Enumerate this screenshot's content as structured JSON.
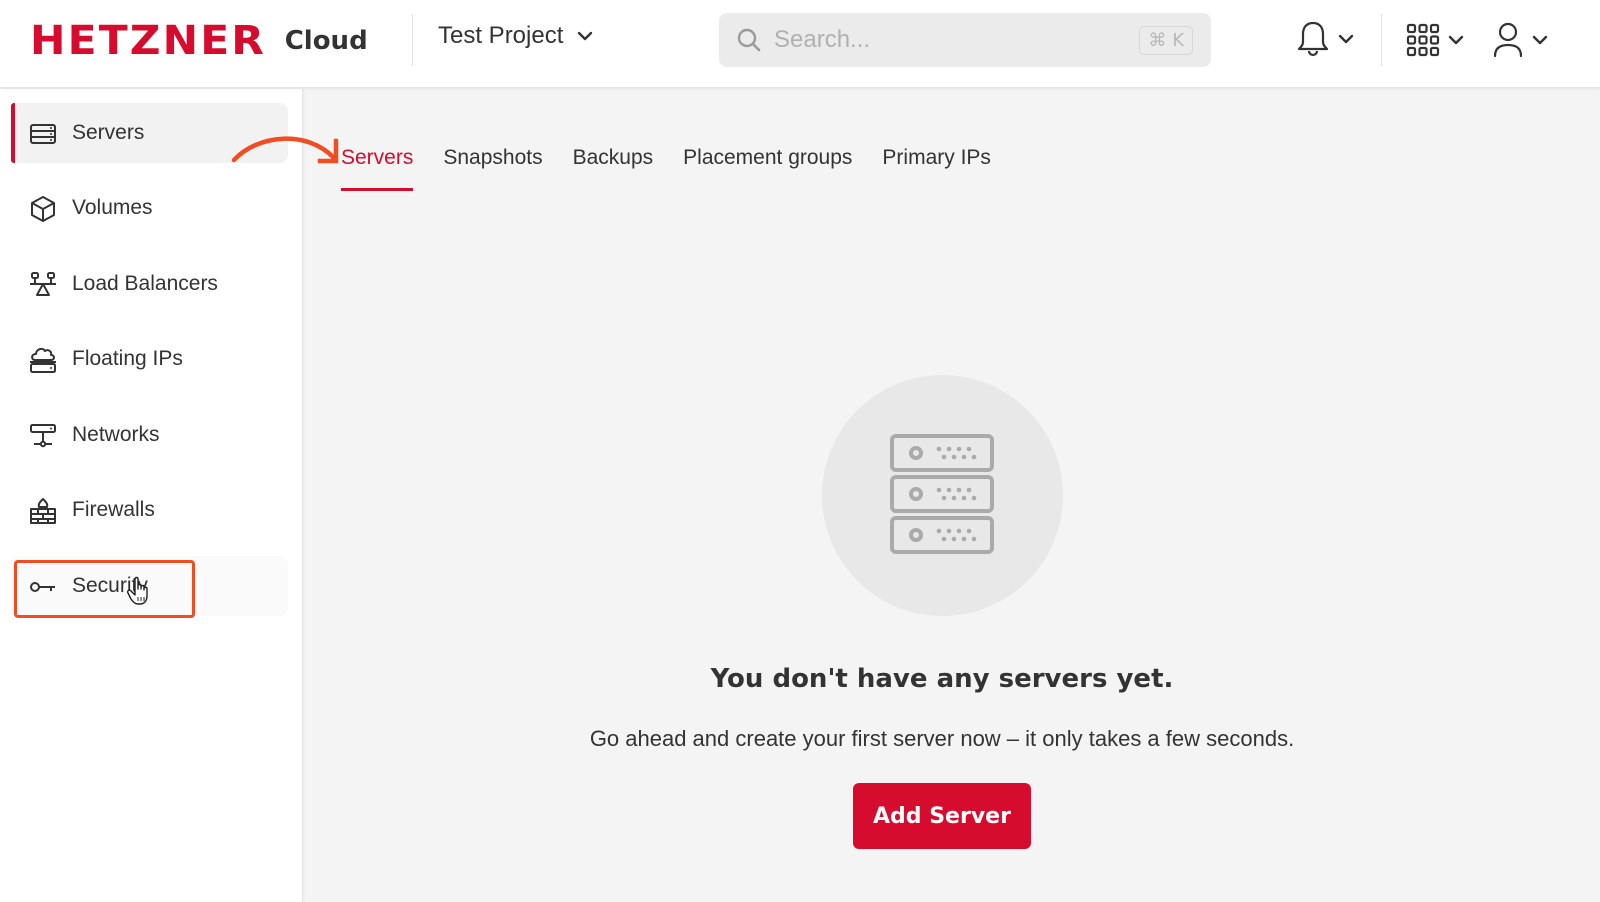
{
  "header": {
    "logo_text": "HETZNER",
    "product_label": "Cloud",
    "project": "Test Project",
    "search": {
      "placeholder": "Search...",
      "value": "",
      "shortcut": "⌘ K"
    },
    "icons": [
      "bell-icon",
      "app-grid-icon",
      "user-icon"
    ]
  },
  "sidebar": {
    "items": [
      {
        "label": "Servers",
        "icon": "server-icon",
        "active": true
      },
      {
        "label": "Volumes",
        "icon": "cube-icon",
        "active": false
      },
      {
        "label": "Load Balancers",
        "icon": "load-balancer-icon",
        "active": false
      },
      {
        "label": "Floating IPs",
        "icon": "floating-ip-icon",
        "active": false
      },
      {
        "label": "Networks",
        "icon": "network-icon",
        "active": false
      },
      {
        "label": "Firewalls",
        "icon": "firewall-icon",
        "active": false
      },
      {
        "label": "Security",
        "icon": "key-icon",
        "active": false,
        "hovered": true
      }
    ]
  },
  "tabs": [
    {
      "label": "Servers",
      "active": true
    },
    {
      "label": "Snapshots",
      "active": false
    },
    {
      "label": "Backups",
      "active": false
    },
    {
      "label": "Placement groups",
      "active": false
    },
    {
      "label": "Primary IPs",
      "active": false
    }
  ],
  "empty_state": {
    "title": "You don't have any servers yet.",
    "description": "Go ahead and create your first server now – it only takes a few seconds.",
    "button_label": "Add Server"
  },
  "colors": {
    "brand": "#d50c2d",
    "annotation": "#f04d23",
    "background": "#f4f4f4"
  }
}
